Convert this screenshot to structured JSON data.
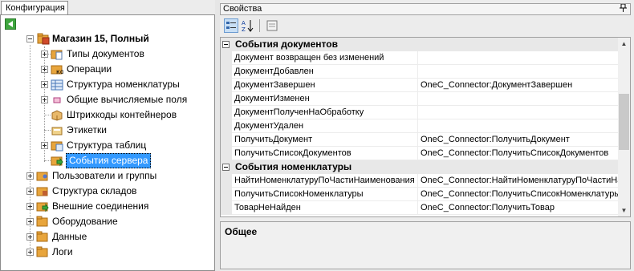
{
  "left_panel": {
    "tab_label": "Конфигурация",
    "tree": {
      "root": "Магазин 15, Полный",
      "children": [
        {
          "label": "Типы документов",
          "icon": "document-types-icon"
        },
        {
          "label": "Операции",
          "icon": "operations-icon"
        },
        {
          "label": "Структура номенклатуры",
          "icon": "table-structure-icon"
        },
        {
          "label": "Общие вычисляемые поля",
          "icon": "computed-fields-icon"
        },
        {
          "label": "Штрихкоды контейнеров",
          "icon": "barcode-box-icon"
        },
        {
          "label": "Этикетки",
          "icon": "labels-icon"
        },
        {
          "label": "Структура таблиц",
          "icon": "tables-folder-icon"
        },
        {
          "label": "События сервера",
          "icon": "server-events-icon",
          "selected": true
        }
      ],
      "top_level": [
        {
          "label": "Пользователи и группы",
          "icon": "users-groups-icon"
        },
        {
          "label": "Структура складов",
          "icon": "warehouses-icon"
        },
        {
          "label": "Внешние соединения",
          "icon": "external-connections-icon"
        },
        {
          "label": "Оборудование",
          "icon": "equipment-icon"
        },
        {
          "label": "Данные",
          "icon": "data-icon"
        },
        {
          "label": "Логи",
          "icon": "logs-icon"
        }
      ]
    }
  },
  "properties_panel": {
    "title": "Свойства",
    "pin_icon": "pin-icon",
    "toolbar": [
      "categorized-icon",
      "sort-az-icon",
      "property-pages-icon"
    ],
    "categories": [
      {
        "name": "События документов",
        "rows": [
          {
            "name": "Документ возвращен без изменений",
            "value": ""
          },
          {
            "name": "ДокументДобавлен",
            "value": ""
          },
          {
            "name": "ДокументЗавершен",
            "value": "OneC_Connector:ДокументЗавершен"
          },
          {
            "name": "ДокументИзменен",
            "value": ""
          },
          {
            "name": "ДокументПолученНаОбработку",
            "value": ""
          },
          {
            "name": "ДокументУдален",
            "value": ""
          },
          {
            "name": "ПолучитьДокумент",
            "value": "OneC_Connector:ПолучитьДокумент"
          },
          {
            "name": "ПолучитьСписокДокументов",
            "value": "OneC_Connector:ПолучитьСписокДокументов"
          }
        ]
      },
      {
        "name": "События номенклатуры",
        "rows": [
          {
            "name": "НайтиНоменклатуруПоЧастиНаименования",
            "value": "OneC_Connector:НайтиНоменклатуруПоЧастиНа"
          },
          {
            "name": "ПолучитьСписокНоменклатуры",
            "value": "OneC_Connector:ПолучитьСписокНоменклатуры"
          },
          {
            "name": "ТоварНеНайден",
            "value": "OneC_Connector:ПолучитьТовар"
          }
        ]
      }
    ],
    "description_title": "Общее"
  }
}
